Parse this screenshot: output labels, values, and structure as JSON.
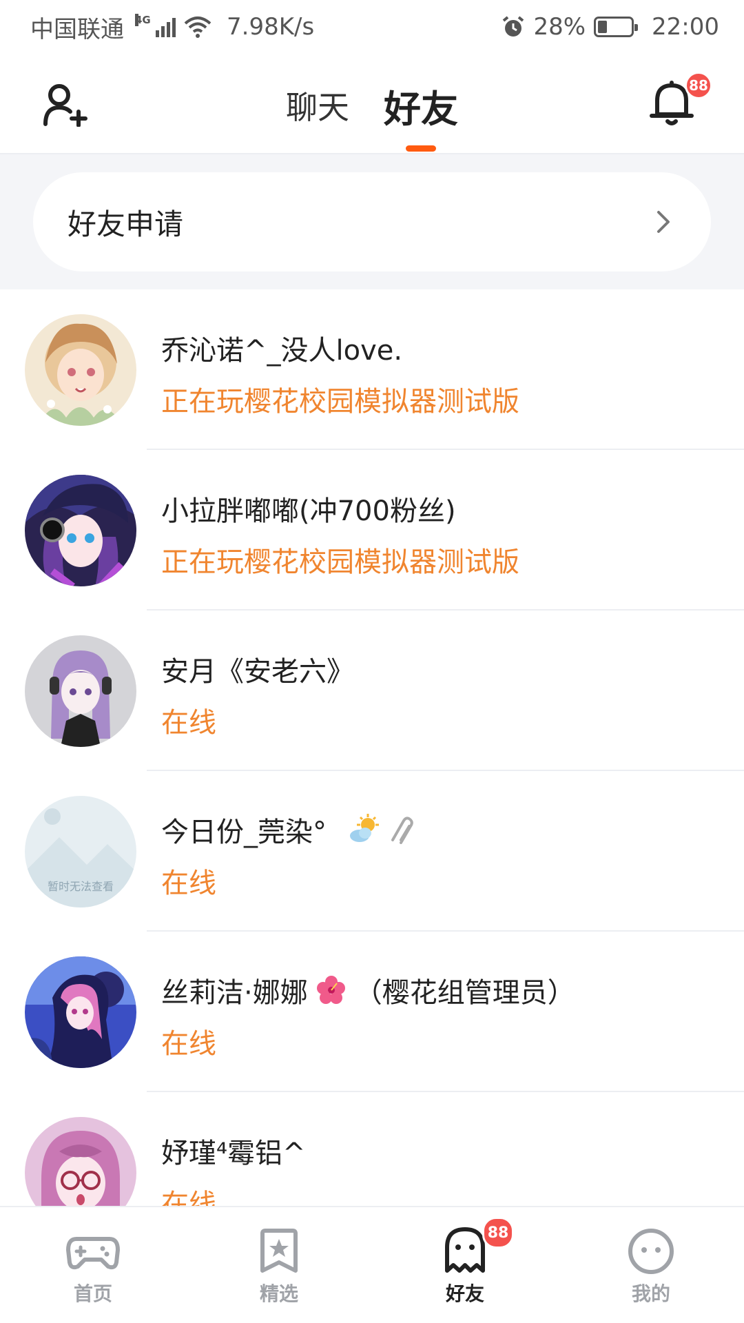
{
  "status_bar": {
    "carrier": "中国联通",
    "network": "4G",
    "speed": "7.98K/s",
    "battery": "28%",
    "battery_level": 0.28,
    "time": "22:00"
  },
  "header": {
    "tabs": [
      {
        "label": "聊天",
        "active": false
      },
      {
        "label": "好友",
        "active": true
      }
    ],
    "notification_badge": "88"
  },
  "friend_request": {
    "label": "好友申请"
  },
  "friends": [
    {
      "name": "乔沁诺^_没人love.",
      "status": "正在玩樱花校园模拟器测试版",
      "name_icons": []
    },
    {
      "name": "小拉胖嘟嘟(冲700粉丝)",
      "status": "正在玩樱花校园模拟器测试版",
      "name_icons": []
    },
    {
      "name": "安月《安老六》",
      "status": "在线",
      "name_icons": []
    },
    {
      "name": "今日份_莞染°",
      "status": "在线",
      "name_icons": [
        "sun-cloud-icon",
        "paperclip-icon"
      ]
    },
    {
      "name": "丝莉洁·娜娜",
      "name_suffix": "（樱花组管理员）",
      "status": "在线",
      "name_icons": [
        "hibiscus-icon"
      ]
    },
    {
      "name": "妤瑾⁴霉铝^",
      "status": "在线",
      "name_icons": []
    }
  ],
  "placeholder_avatar_text": "暂时无法查看",
  "colors": {
    "accent": "#ff5b10",
    "status_orange": "#f0852f",
    "badge_red": "#f4524d"
  },
  "bottom_nav": {
    "items": [
      {
        "label": "首页",
        "icon": "gamepad-icon",
        "active": false
      },
      {
        "label": "精选",
        "icon": "star-bookmark-icon",
        "active": false
      },
      {
        "label": "好友",
        "icon": "ghost-icon",
        "active": true,
        "badge": "88"
      },
      {
        "label": "我的",
        "icon": "face-icon",
        "active": false
      }
    ]
  }
}
